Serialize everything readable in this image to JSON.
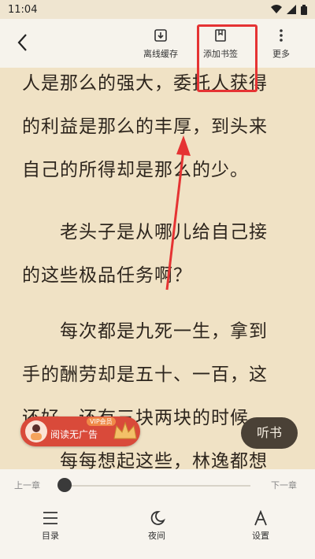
{
  "status": {
    "time": "11:04"
  },
  "toolbar": {
    "offline_cache": "离线缓存",
    "add_bookmark": "添加书签",
    "more": "更多"
  },
  "reader": {
    "lines": [
      "人是那么的强大，委托人获得",
      "的利益是那么的丰厚，到头来",
      "自己的所得却是那么的少。",
      "老头子是从哪儿给自己接",
      "的这些极品任务啊？",
      "每次都是九死一生，拿到",
      "手的酬劳却是五十、一百，这",
      "还好，还有三块两块的时候。",
      "每每想起这些，林逸都想"
    ]
  },
  "ad": {
    "label": "阅读无广告",
    "vip_tag": "VIP会员"
  },
  "listen_button": "听书",
  "progress": {
    "prev": "上一章",
    "next": "下一章",
    "value": 0.0
  },
  "bottom": {
    "catalog": "目录",
    "night": "夜间",
    "settings": "设置"
  },
  "colors": {
    "highlight": "#e53333",
    "paper": "#f0e2c5",
    "bar": "#f7f4ee"
  }
}
